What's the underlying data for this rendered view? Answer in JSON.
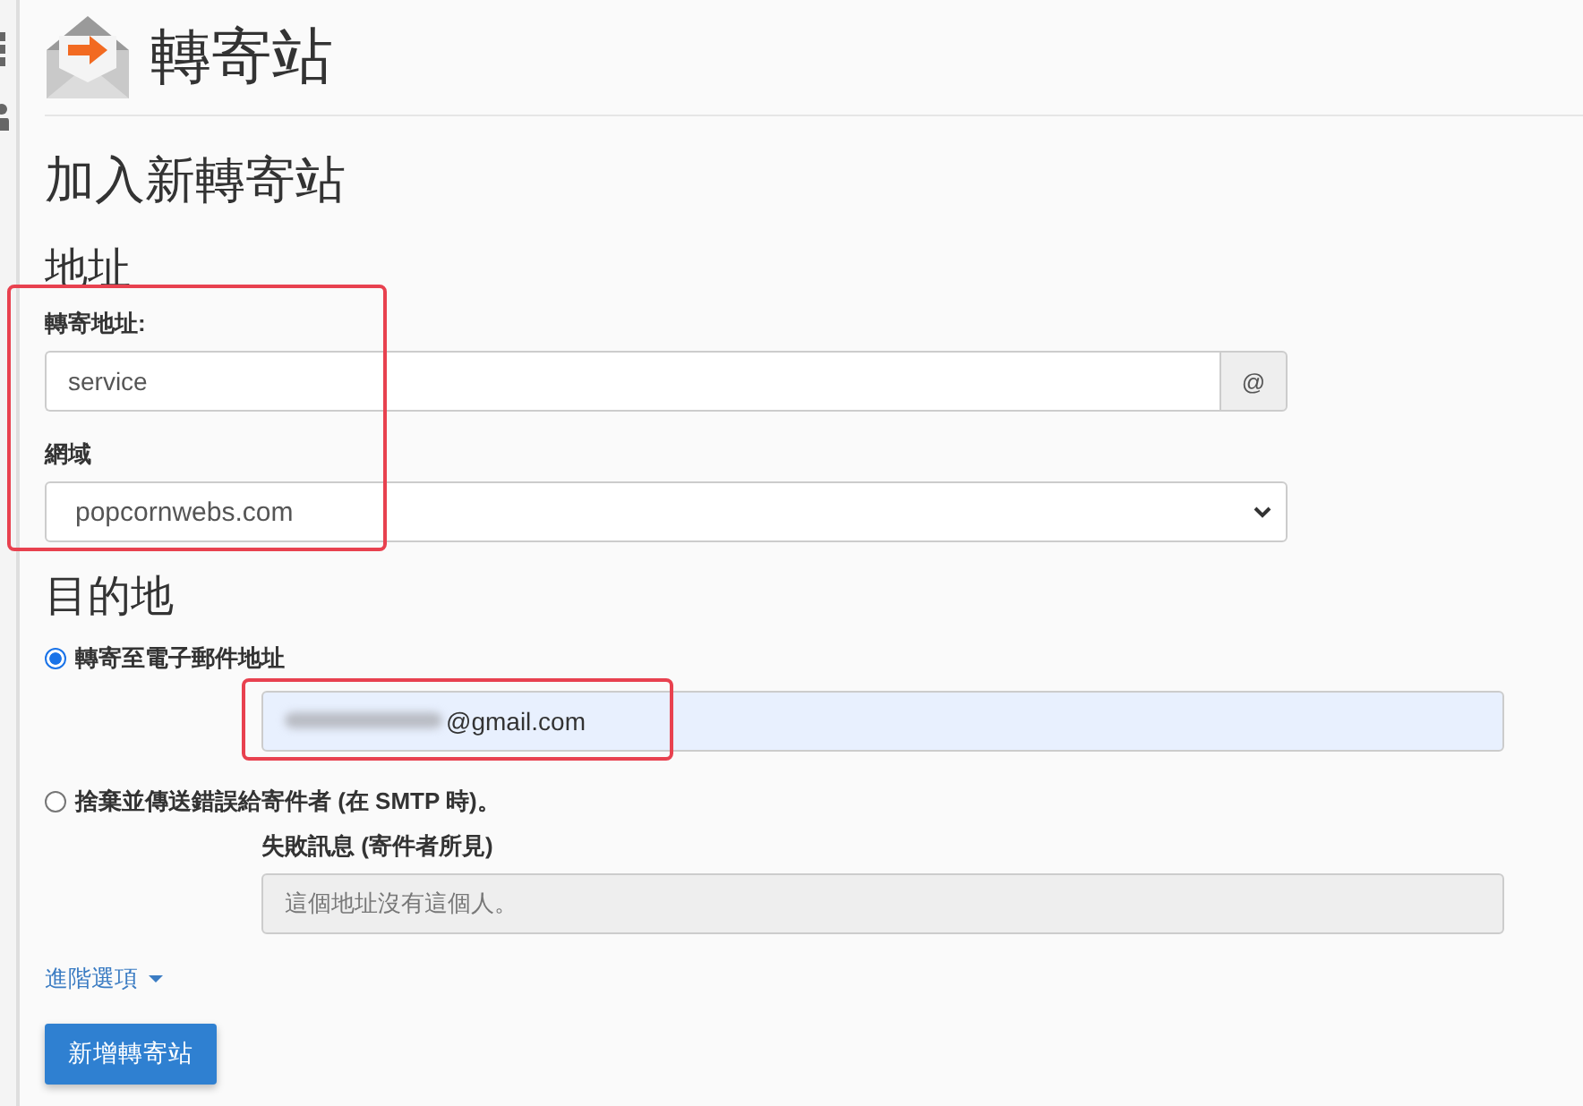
{
  "header": {
    "title": "轉寄站"
  },
  "page_heading": "加入新轉寄站",
  "address_section": {
    "heading": "地址",
    "highlighted": true,
    "forward_address": {
      "label": "轉寄地址:",
      "value": "service",
      "addon": "@"
    },
    "domain": {
      "label": "網域",
      "value": "popcornwebs.com"
    }
  },
  "destination_section": {
    "heading": "目的地",
    "options": [
      {
        "kind": "email",
        "label": "轉寄至電子郵件地址",
        "selected": true,
        "field": {
          "value": "@gmail.com",
          "blurred_prefix": true,
          "autofilled": true,
          "highlighted": true
        }
      },
      {
        "kind": "fail",
        "label": "捨棄並傳送錯誤給寄件者 (在 SMTP 時)。",
        "selected": false,
        "message_label": "失敗訊息 (寄件者所見)",
        "field": {
          "value": "這個地址沒有這個人。",
          "disabled": true
        }
      }
    ]
  },
  "advanced_link": {
    "label": "進階選項"
  },
  "submit_button": {
    "label": "新增轉寄站"
  }
}
